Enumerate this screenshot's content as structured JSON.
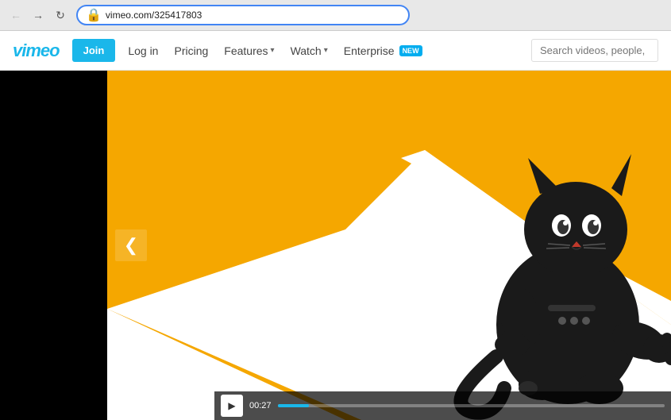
{
  "browser": {
    "url": "vimeo.com/325417803",
    "back_btn": "←",
    "forward_btn": "→",
    "refresh_btn": "↻"
  },
  "nav": {
    "logo": "vimeo",
    "join_label": "Join",
    "login_label": "Log in",
    "pricing_label": "Pricing",
    "features_label": "Features",
    "watch_label": "Watch",
    "enterprise_label": "Enterprise",
    "enterprise_badge": "NEW",
    "search_placeholder": "Search videos, people,",
    "chevron": "▾"
  },
  "video": {
    "time_current": "00",
    "time_total": "27",
    "time_display": "00:27",
    "left_arrow": "❮",
    "play_icon": "▶"
  }
}
